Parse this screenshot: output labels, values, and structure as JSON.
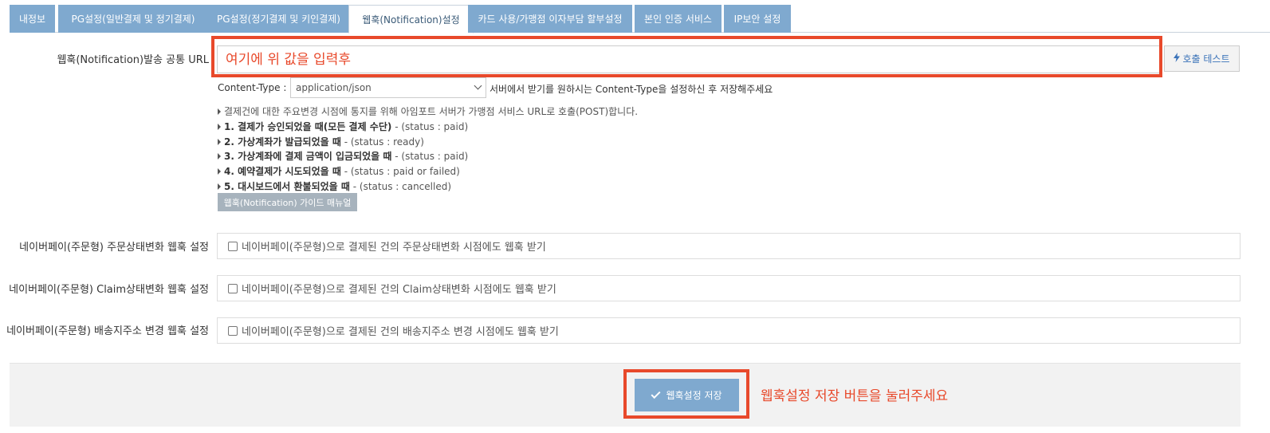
{
  "tabs": [
    {
      "label": "내정보"
    },
    {
      "label": "PG설정(일반결제 및 정기결제)"
    },
    {
      "label": "PG설정(정기결제 및 키인결제)"
    },
    {
      "label": "웹훅(Notification)설정",
      "active": true
    },
    {
      "label": "카드 사용/가맹점 이자부담 할부설정"
    },
    {
      "label": "본인 인증 서비스"
    },
    {
      "label": "IP보안 설정"
    }
  ],
  "webhook": {
    "url_label": "웹훅(Notification)발송 공통 URL",
    "url_placeholder": "여기에 위 값을 입력후",
    "test_button": "호출 테스트",
    "content_type_label": "Content-Type :",
    "content_type_value": "application/json",
    "content_type_note": "서버에서 받기를 원하시는 Content-Type을 설정하신 후 저장해주세요",
    "intro": "결제건에 대한 주요변경 시점에 통지를 위해 아임포트 서버가 가맹점 서비스 URL로 호출(POST)합니다.",
    "events": [
      {
        "bold": "1. 결제가 승인되었을 때(모든 결제 수단)",
        "rest": " - (status : paid)"
      },
      {
        "bold": "2. 가상계좌가 발급되었을 때",
        "rest": " - (status : ready)"
      },
      {
        "bold": "3. 가상계좌에 결제 금액이 입금되었을 때",
        "rest": " - (status : paid)"
      },
      {
        "bold": "4. 예약결제가 시도되었을 때",
        "rest": " - (status : paid or failed)"
      },
      {
        "bold": "5. 대시보드에서 환불되었을 때",
        "rest": " - (status : cancelled)"
      }
    ],
    "guide_button": "웹훅(Notification) 가이드 매뉴얼"
  },
  "naverpay": [
    {
      "label": "네이버페이(주문형) 주문상태변화 웹훅 설정",
      "checkbox_label": "네이버페이(주문형)으로 결제된 건의 주문상태변화 시점에도 웹훅 받기",
      "checked": false
    },
    {
      "label": "네이버페이(주문형) Claim상태변화 웹훅 설정",
      "checkbox_label": "네이버페이(주문형)으로 결제된 건의 Claim상태변화 시점에도 웹훅 받기",
      "checked": false
    },
    {
      "label": "네이버페이(주문형) 배송지주소 변경 웹훅 설정",
      "checkbox_label": "네이버페이(주문형)으로 결제된 건의 배송지주소 변경 시점에도 웹훅 받기",
      "checked": false
    }
  ],
  "footer": {
    "save_button": "웹훅설정 저장",
    "save_note": "웹훅설정 저장 버튼을 눌러주세요"
  },
  "colors": {
    "tab_bg": "#7fa9cf",
    "annotation_red": "#e8492b",
    "link_blue": "#3b73b9"
  }
}
